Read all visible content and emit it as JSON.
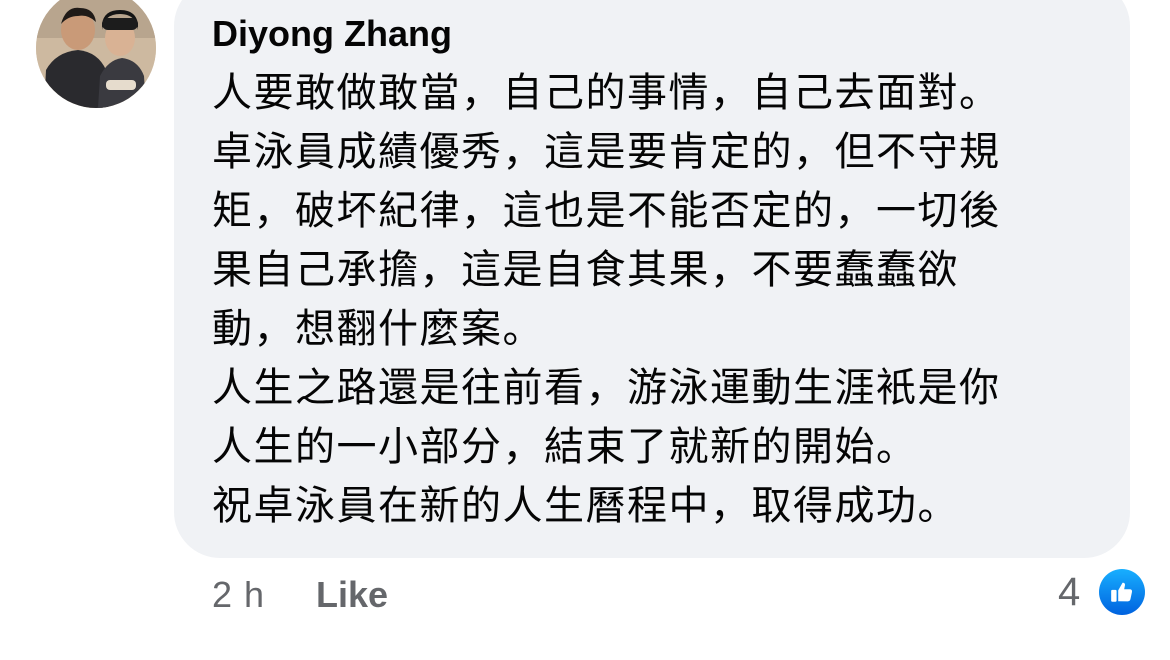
{
  "comment": {
    "author": "Diyong Zhang",
    "lines": [
      "人要敢做敢當，自己的事情，自己去面對。",
      "卓泳員成績優秀，這是要肯定的，但不守規",
      "矩，破坏紀律，這也是不能否定的，一切後",
      "果自己承擔，這是自食其果，不要蠢蠢欲",
      "動，想翻什麼案。",
      "人生之路還是往前看，游泳運動生涯衹是你",
      "人生的一小部分，結束了就新的開始。",
      "祝卓泳員在新的人生曆程中，取得成功。"
    ],
    "timestamp": "2 h",
    "like_label": "Like",
    "reaction_count": "4"
  },
  "icons": {
    "avatar": "avatar-photo",
    "reaction": "thumbs-up-icon"
  },
  "colors": {
    "bubble_background": "#f0f2f5",
    "secondary_text": "#65676b",
    "like_badge": "#1877f2"
  }
}
